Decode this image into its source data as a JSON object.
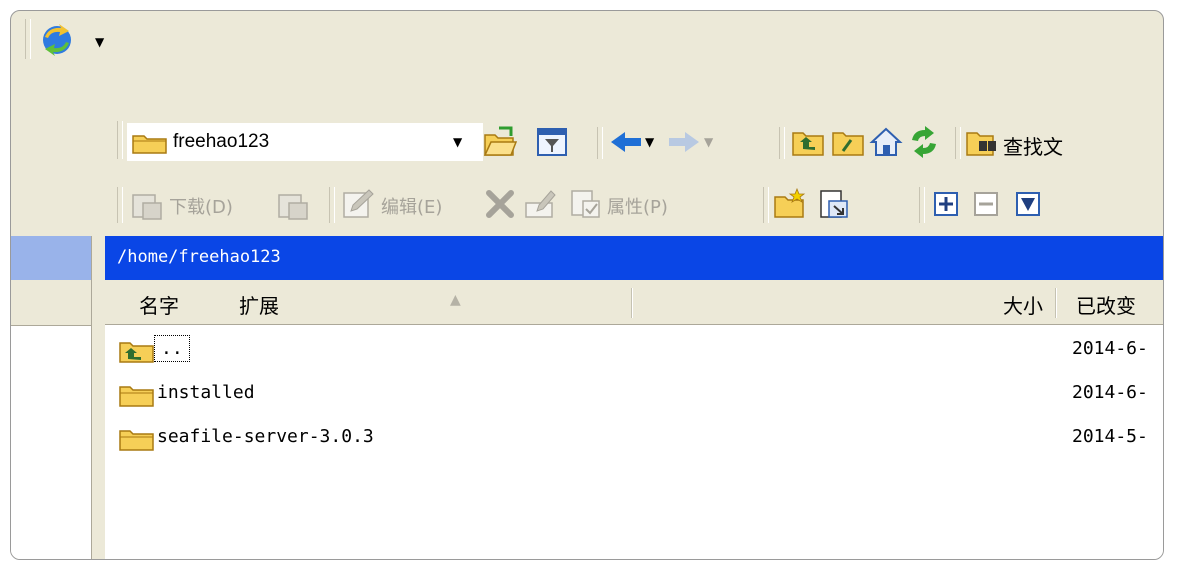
{
  "toolbar": {
    "path_value": "freehao123",
    "find_label": "查找文",
    "download_label": "下载(D)",
    "edit_label": "编辑(E)",
    "properties_label": "属性(P)"
  },
  "path_bar": {
    "path": "/home/freehao123"
  },
  "columns": {
    "name": "名字",
    "ext": "扩展",
    "size": "大小",
    "modified": "已改变"
  },
  "files": [
    {
      "name": "..",
      "modified": "2014-6-"
    },
    {
      "name": "installed",
      "modified": "2014-6-"
    },
    {
      "name": "seafile-server-3.0.3",
      "modified": "2014-5-"
    }
  ],
  "colors": {
    "selection": "#0a46e6",
    "panel": "#ece9d8",
    "left_header": "#99b3ea",
    "folder": "#f6cf57"
  }
}
